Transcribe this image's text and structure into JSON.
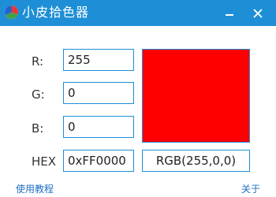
{
  "window": {
    "title": "小皮拾色器",
    "minimize_icon": "minimize-icon",
    "close_icon": "close-icon",
    "titlebar_color": "#1e8fd6"
  },
  "fields": {
    "r_label": "R:",
    "r_value": "255",
    "g_label": "G:",
    "g_value": "0",
    "b_label": "B:",
    "b_value": "0",
    "hex_label": "HEX",
    "hex_value": "0xFF0000"
  },
  "preview": {
    "color": "#ff0000",
    "rgb_text": "RGB(255,0,0)"
  },
  "footer": {
    "tutorial_link": "使用教程",
    "about_link": "关于"
  }
}
